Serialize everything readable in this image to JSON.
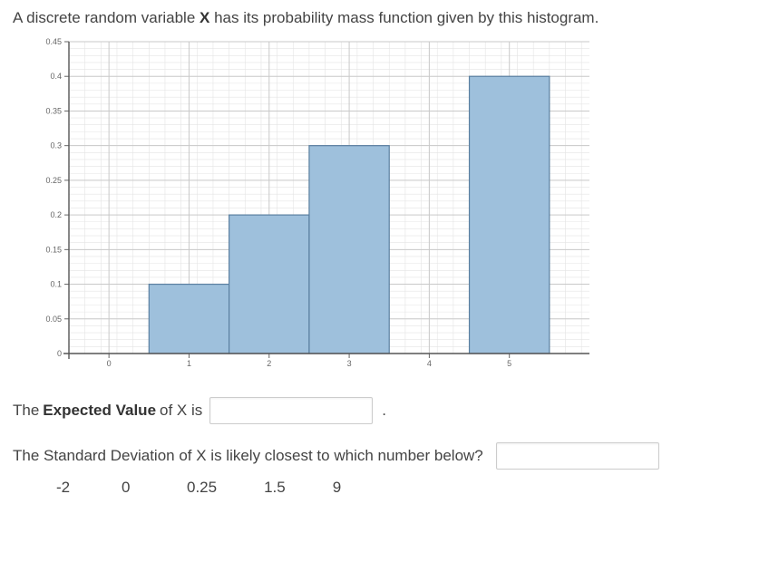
{
  "prompt_pre": "A discrete random variable ",
  "prompt_bold": "X",
  "prompt_post": " has its probability mass function given by this histogram.",
  "chart_data": {
    "type": "bar",
    "categories": [
      "1",
      "2",
      "3",
      "5"
    ],
    "values": [
      0.1,
      0.2,
      0.3,
      0.4
    ],
    "y_ticks": [
      0,
      0.05,
      0.1,
      0.15,
      0.2,
      0.25,
      0.3,
      0.35,
      0.4,
      0.45
    ],
    "x_ticks": [
      0,
      1,
      2,
      3,
      4,
      5
    ],
    "bar_fill": "#9ec0dc",
    "bar_stroke": "#5a7fa0",
    "ylim": [
      0,
      0.45
    ]
  },
  "q1_before": "The ",
  "q1_bold": "Expected Value",
  "q1_mid": " of X is ",
  "q1_after": ".",
  "q1_value": "",
  "q2_text": "The Standard Deviation of X is likely closest to which number below?",
  "q2_value": "",
  "choices": [
    "-2",
    "0",
    "0.25",
    "1.5",
    "9"
  ]
}
